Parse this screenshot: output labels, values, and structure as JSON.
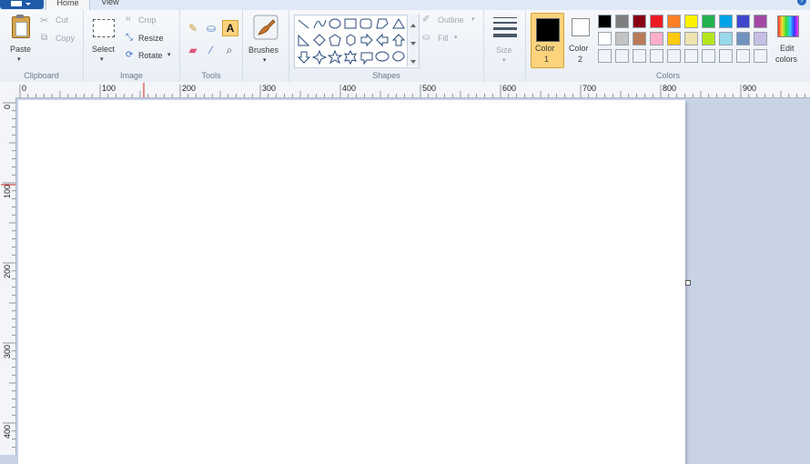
{
  "tabs": {
    "home": "Home",
    "view": "View",
    "help": "?"
  },
  "clipboard": {
    "paste": "Paste",
    "cut": "Cut",
    "copy": "Copy",
    "group": "Clipboard"
  },
  "image": {
    "select": "Select",
    "crop": "Crop",
    "resize": "Resize",
    "rotate": "Rotate",
    "group": "Image"
  },
  "tools": {
    "text_glyph": "A",
    "group": "Tools"
  },
  "brushes": {
    "label": "Brushes"
  },
  "shapes": {
    "outline": "Outline",
    "fill": "Fill",
    "group": "Shapes"
  },
  "size": {
    "label": "Size"
  },
  "colors": {
    "color1_line1": "Color",
    "color1_line2": "1",
    "color2_line1": "Color",
    "color2_line2": "2",
    "edit_line1": "Edit",
    "edit_line2": "colors",
    "group": "Colors",
    "color1": "#000000",
    "color2": "#ffffff",
    "palette_row1": [
      "#000000",
      "#7f7f7f",
      "#880015",
      "#ed1c24",
      "#ff7f27",
      "#fff200",
      "#22b14c",
      "#00a2e8",
      "#3f48cc",
      "#a349a4"
    ],
    "palette_row2": [
      "#ffffff",
      "#c3c3c3",
      "#b97a57",
      "#ffaec9",
      "#ffc90e",
      "#efe4b0",
      "#b5e61d",
      "#99d9ea",
      "#7092be",
      "#c8bfe7"
    ],
    "palette_row3": [
      "#f0f4f9",
      "#f0f4f9",
      "#f0f4f9",
      "#f0f4f9",
      "#f0f4f9",
      "#f0f4f9",
      "#f0f4f9",
      "#f0f4f9",
      "#f0f4f9",
      "#f0f4f9"
    ]
  },
  "rulers": {
    "h_labels": [
      "0",
      "100",
      "200",
      "300",
      "400",
      "500",
      "600",
      "700",
      "800",
      "900"
    ],
    "v_labels": [
      "0",
      "100",
      "200",
      "300",
      "400"
    ]
  }
}
